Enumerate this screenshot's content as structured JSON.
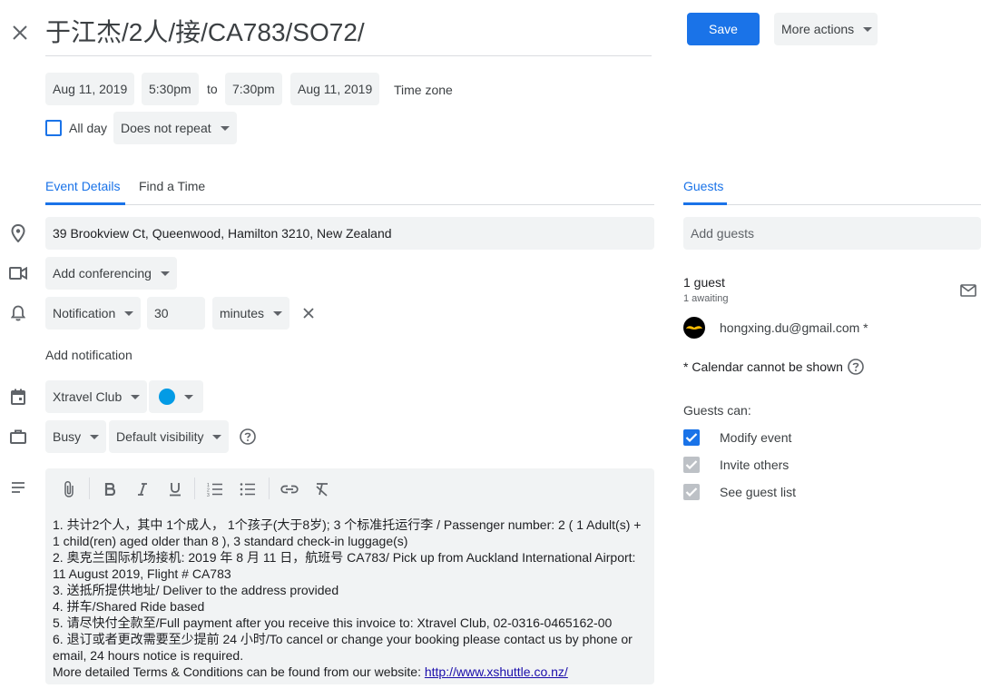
{
  "header": {
    "title": "于江杰/2人/接/CA783/SO72/",
    "save_label": "Save",
    "more_actions_label": "More actions"
  },
  "datetime": {
    "start_date": "Aug 11, 2019",
    "start_time": "5:30pm",
    "to_label": "to",
    "end_time": "7:30pm",
    "end_date": "Aug 11, 2019",
    "timezone_label": "Time zone",
    "all_day_label": "All day",
    "repeat_value": "Does not repeat"
  },
  "tabs": {
    "event_details": "Event Details",
    "find_time": "Find a Time",
    "guests": "Guests"
  },
  "details": {
    "location": "39 Brookview Ct, Queenwood, Hamilton 3210, New Zealand",
    "conferencing_label": "Add conferencing",
    "notification_type": "Notification",
    "notification_value": "30",
    "notification_unit": "minutes",
    "add_notification_label": "Add notification",
    "calendar_name": "Xtravel Club",
    "calendar_color": "#039be5",
    "availability": "Busy",
    "visibility": "Default visibility"
  },
  "description": {
    "lines": [
      "1. 共计2个人，其中 1个成人， 1个孩子(大于8岁); 3 个标准托运行李 / Passenger number: 2 ( 1 Adult(s) +",
      "1 child(ren) aged older than 8 ), 3 standard check-in luggage(s)",
      "2. 奥克兰国际机场接机: 2019 年 8 月 11 日，航班号 CA783/ Pick up from Auckland International Airport:",
      "11 August 2019, Flight # CA783",
      "3. 送抵所提供地址/ Deliver to the address provided",
      "4. 拼车/Shared Ride based",
      "5. 请尽快付全款至/Full payment after you receive this invoice to: Xtravel Club, 02-0316-0465162-00",
      "6. 退订或者更改需要至少提前 24 小时/To cancel or change your booking please contact us by phone or",
      "email, 24 hours notice is required."
    ],
    "terms_prefix": "More detailed Terms & Conditions can be found from our website: ",
    "terms_link": "http://www.xshuttle.co.nz/"
  },
  "guests": {
    "add_placeholder": "Add guests",
    "count_label": "1 guest",
    "awaiting_label": "1 awaiting",
    "guest_email": "hongxing.du@gmail.com *",
    "calendar_note": "* Calendar cannot be shown",
    "guests_can_label": "Guests can:",
    "permissions": [
      {
        "label": "Modify event",
        "checked": true,
        "enabled": true
      },
      {
        "label": "Invite others",
        "checked": true,
        "enabled": false
      },
      {
        "label": "See guest list",
        "checked": true,
        "enabled": false
      }
    ]
  },
  "colors": {
    "accent": "#1a73e8",
    "chip_bg": "#f1f3f4",
    "disabled_check": "#bdc1c6"
  },
  "icons": [
    "close-icon",
    "location-icon",
    "video-icon",
    "bell-icon",
    "calendar-icon",
    "briefcase-icon",
    "description-icon",
    "help-icon",
    "mail-icon",
    "attach-icon",
    "bold-icon",
    "italic-icon",
    "underline-icon",
    "numbered-list-icon",
    "bulleted-list-icon",
    "link-icon",
    "clear-format-icon"
  ]
}
